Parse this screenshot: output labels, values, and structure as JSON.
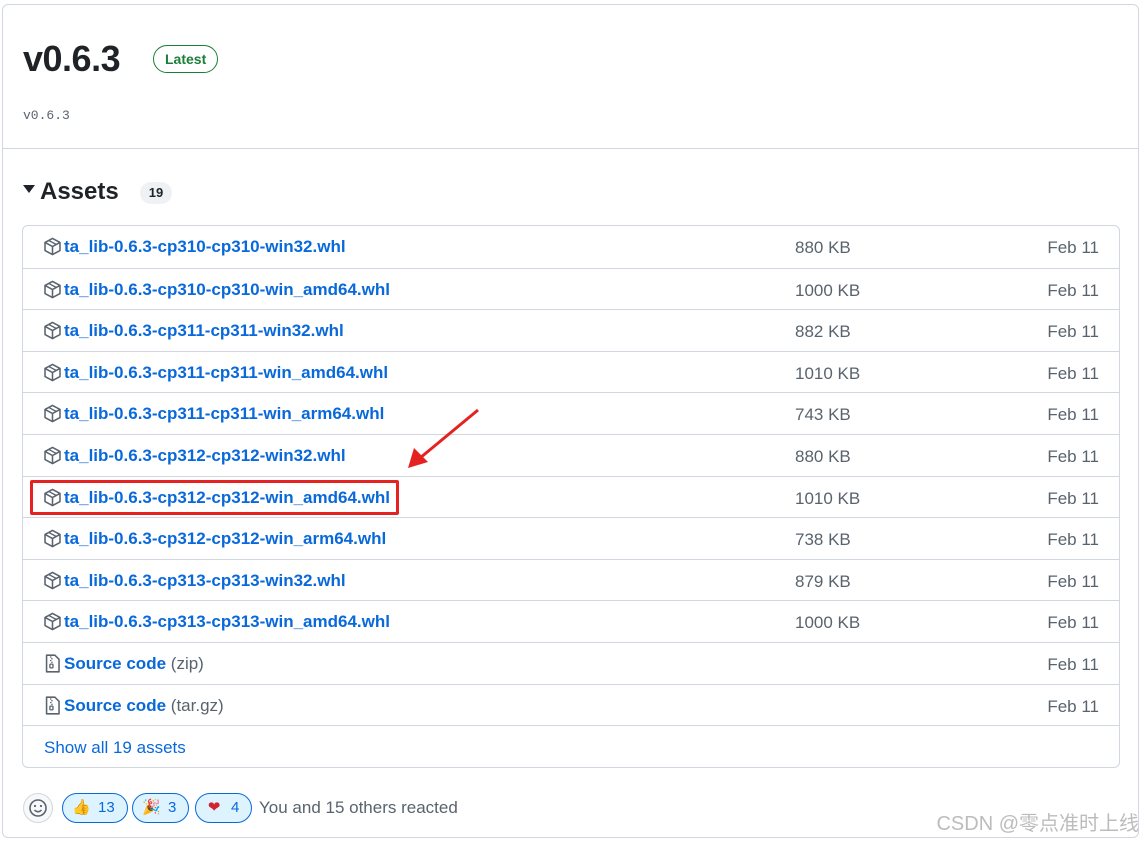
{
  "release": {
    "title": "v0.6.3",
    "badge": "Latest",
    "tag": "v0.6.3"
  },
  "assets": {
    "heading": "Assets",
    "count": "19",
    "items": [
      {
        "name": "ta_lib-0.6.3-cp310-cp310-win32.whl",
        "size": "880 KB",
        "date": "Feb 11",
        "icon": "package-icon"
      },
      {
        "name": "ta_lib-0.6.3-cp310-cp310-win_amd64.whl",
        "size": "1000 KB",
        "date": "Feb 11",
        "icon": "package-icon"
      },
      {
        "name": "ta_lib-0.6.3-cp311-cp311-win32.whl",
        "size": "882 KB",
        "date": "Feb 11",
        "icon": "package-icon"
      },
      {
        "name": "ta_lib-0.6.3-cp311-cp311-win_amd64.whl",
        "size": "1010 KB",
        "date": "Feb 11",
        "icon": "package-icon"
      },
      {
        "name": "ta_lib-0.6.3-cp311-cp311-win_arm64.whl",
        "size": "743 KB",
        "date": "Feb 11",
        "icon": "package-icon"
      },
      {
        "name": "ta_lib-0.6.3-cp312-cp312-win32.whl",
        "size": "880 KB",
        "date": "Feb 11",
        "icon": "package-icon"
      },
      {
        "name": "ta_lib-0.6.3-cp312-cp312-win_amd64.whl",
        "size": "1010 KB",
        "date": "Feb 11",
        "icon": "package-icon"
      },
      {
        "name": "ta_lib-0.6.3-cp312-cp312-win_arm64.whl",
        "size": "738 KB",
        "date": "Feb 11",
        "icon": "package-icon"
      },
      {
        "name": "ta_lib-0.6.3-cp313-cp313-win32.whl",
        "size": "879 KB",
        "date": "Feb 11",
        "icon": "package-icon"
      },
      {
        "name": "ta_lib-0.6.3-cp313-cp313-win_amd64.whl",
        "size": "1000 KB",
        "date": "Feb 11",
        "icon": "package-icon"
      }
    ],
    "source": [
      {
        "name": "Source code",
        "format": "(zip)",
        "date": "Feb 11",
        "icon": "file-zip-icon"
      },
      {
        "name": "Source code",
        "format": "(tar.gz)",
        "date": "Feb 11",
        "icon": "file-zip-icon"
      }
    ],
    "show_all": "Show all 19 assets"
  },
  "reactions": {
    "items": [
      {
        "icon": "thumbs-up-icon",
        "count": "13"
      },
      {
        "icon": "tada-icon",
        "count": "3"
      },
      {
        "icon": "heart-icon",
        "count": "4"
      }
    ],
    "summary": "You and 15 others reacted"
  },
  "watermark": "CSDN @零点准时上线",
  "colors": {
    "link": "#0969da",
    "latest_green": "#1a7f37",
    "highlight_red": "#e52222"
  }
}
